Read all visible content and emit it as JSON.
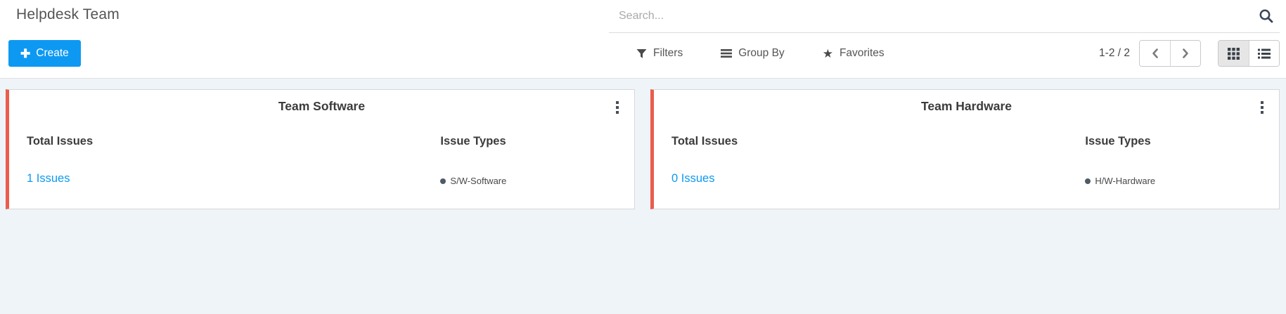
{
  "page": {
    "title": "Helpdesk Team"
  },
  "search": {
    "placeholder": "Search..."
  },
  "toolbar": {
    "create_label": "Create",
    "filters_label": "Filters",
    "group_by_label": "Group By",
    "favorites_label": "Favorites"
  },
  "pager": {
    "range_label": "1-2 / 2"
  },
  "view_switcher": {
    "active": "kanban",
    "options": [
      "kanban",
      "list"
    ]
  },
  "cards": [
    {
      "title": "Team Software",
      "total_issues_label": "Total Issues",
      "issue_types_label": "Issue Types",
      "issues_count_link": "1 Issues",
      "legend_label": "S/W-Software"
    },
    {
      "title": "Team Hardware",
      "total_issues_label": "Total Issues",
      "issue_types_label": "Issue Types",
      "issues_count_link": "0 Issues",
      "legend_label": "H/W-Hardware"
    }
  ],
  "colors": {
    "primary_blue": "#0d99f2",
    "card_accent_red": "#ea5c4c",
    "legend_dot": "#4e5a66",
    "page_bg": "#eff4f8"
  }
}
